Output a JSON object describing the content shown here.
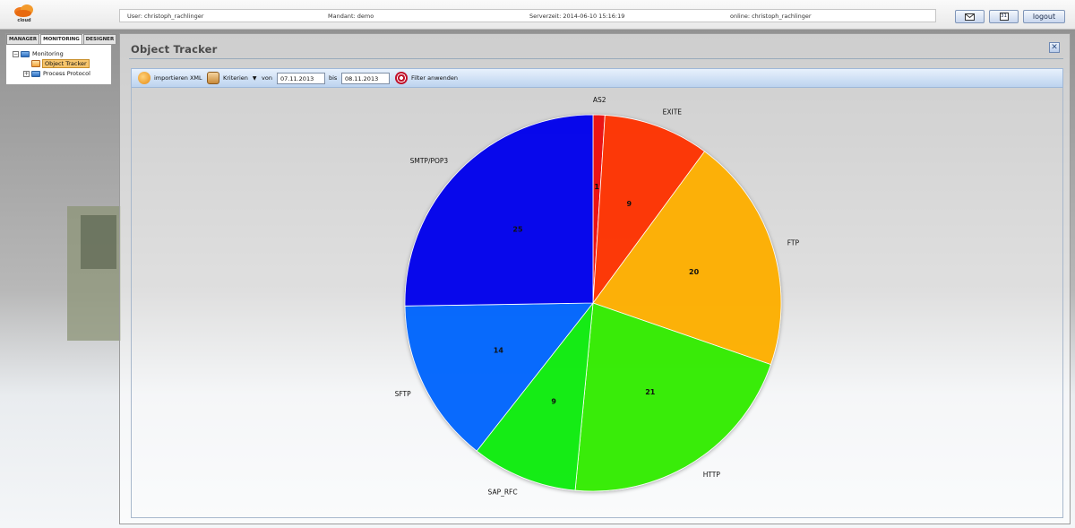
{
  "app": {
    "logo_text": "cloud"
  },
  "header": {
    "user": "User: christoph_rachlinger",
    "mandant": "Mandant: demo",
    "serverzeit": "Serverzeit: 2014-06-10 15:16:19",
    "online": "online: christoph_rachlinger",
    "mail_icon": "envelope-icon",
    "calendar_label": "31",
    "logout_label": "logout"
  },
  "nav": {
    "tabs": [
      {
        "label": "MANAGER"
      },
      {
        "label": "MONITORING"
      },
      {
        "label": "DESIGNER"
      }
    ],
    "tree": {
      "root": "Monitoring",
      "children": [
        "Object Tracker",
        "Process Protocol"
      ],
      "selected": "Object Tracker"
    }
  },
  "main": {
    "title": "Object Tracker",
    "close_icon": "close-icon",
    "toolbar": {
      "import_label": "importieren XML",
      "criteria_label": "Kriterien",
      "von_label": "von",
      "von_value": "07.11.2013",
      "bis_label": "bis",
      "bis_value": "08.11.2013",
      "filter_label": "Filter anwenden"
    }
  },
  "chart_data": {
    "type": "pie",
    "categories": [
      "AS2",
      "EXITE",
      "FTP",
      "HTTP",
      "SAP_RFC",
      "SFTP",
      "SMTP/POP3"
    ],
    "values": [
      1,
      9,
      20,
      21,
      9,
      14,
      25
    ],
    "colors": [
      "#ee1111",
      "#ff3300",
      "#ffb000",
      "#33ee00",
      "#11ee11",
      "#0066ff",
      "#0000ee"
    ],
    "start": "top",
    "direction": "clockwise"
  }
}
